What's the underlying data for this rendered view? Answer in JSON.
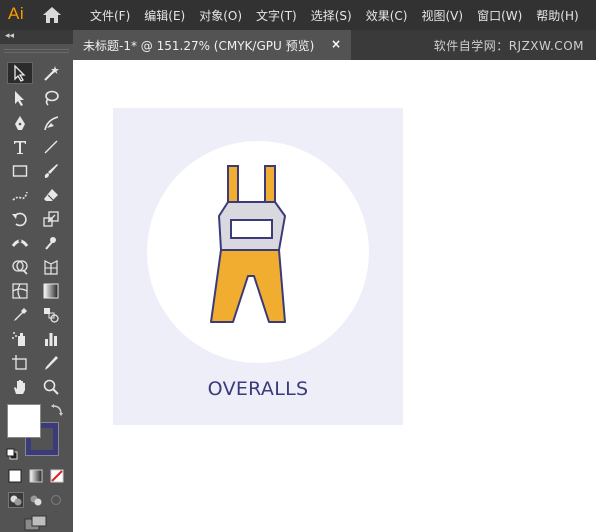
{
  "app": {
    "logo_text": "Ai",
    "logo_color": "#ff9a00"
  },
  "menu": {
    "items": [
      "文件(F)",
      "编辑(E)",
      "对象(O)",
      "文字(T)",
      "选择(S)",
      "效果(C)",
      "视图(V)",
      "窗口(W)",
      "帮助(H)"
    ]
  },
  "tab": {
    "title": "未标题-1* @ 151.27% (CMYK/GPU 预览)",
    "close_symbol": "×"
  },
  "watermark": "软件自学网：RJZXW.COM",
  "tools": [
    [
      "selection-tool-icon",
      "magic-wand-tool-icon"
    ],
    [
      "direct-selection-tool-icon",
      "lasso-tool-icon"
    ],
    [
      "pen-tool-icon",
      "curvature-tool-icon"
    ],
    [
      "type-tool-icon",
      "line-segment-tool-icon"
    ],
    [
      "rectangle-tool-icon",
      "paintbrush-tool-icon"
    ],
    [
      "shaper-tool-icon",
      "eraser-tool-icon"
    ],
    [
      "rotate-tool-icon",
      "scale-tool-icon"
    ],
    [
      "width-tool-icon",
      "puppet-warp-tool-icon"
    ],
    [
      "shape-builder-tool-icon",
      "perspective-grid-tool-icon"
    ],
    [
      "mesh-tool-icon",
      "gradient-tool-icon"
    ],
    [
      "eyedropper-tool-icon",
      "blend-tool-icon"
    ],
    [
      "symbol-sprayer-tool-icon",
      "column-graph-tool-icon"
    ],
    [
      "artboard-tool-icon",
      "slice-tool-icon"
    ],
    [
      "hand-tool-icon",
      "zoom-tool-icon"
    ]
  ],
  "colors": {
    "fill": "#ffffff",
    "stroke": "#3b3a7a",
    "artboard_bg": "#eeeef8",
    "overalls_yellow": "#f0ad30",
    "overalls_gray": "#d8d8de",
    "outline": "#3b3a7a"
  },
  "artwork": {
    "label": "OVERALLS"
  }
}
